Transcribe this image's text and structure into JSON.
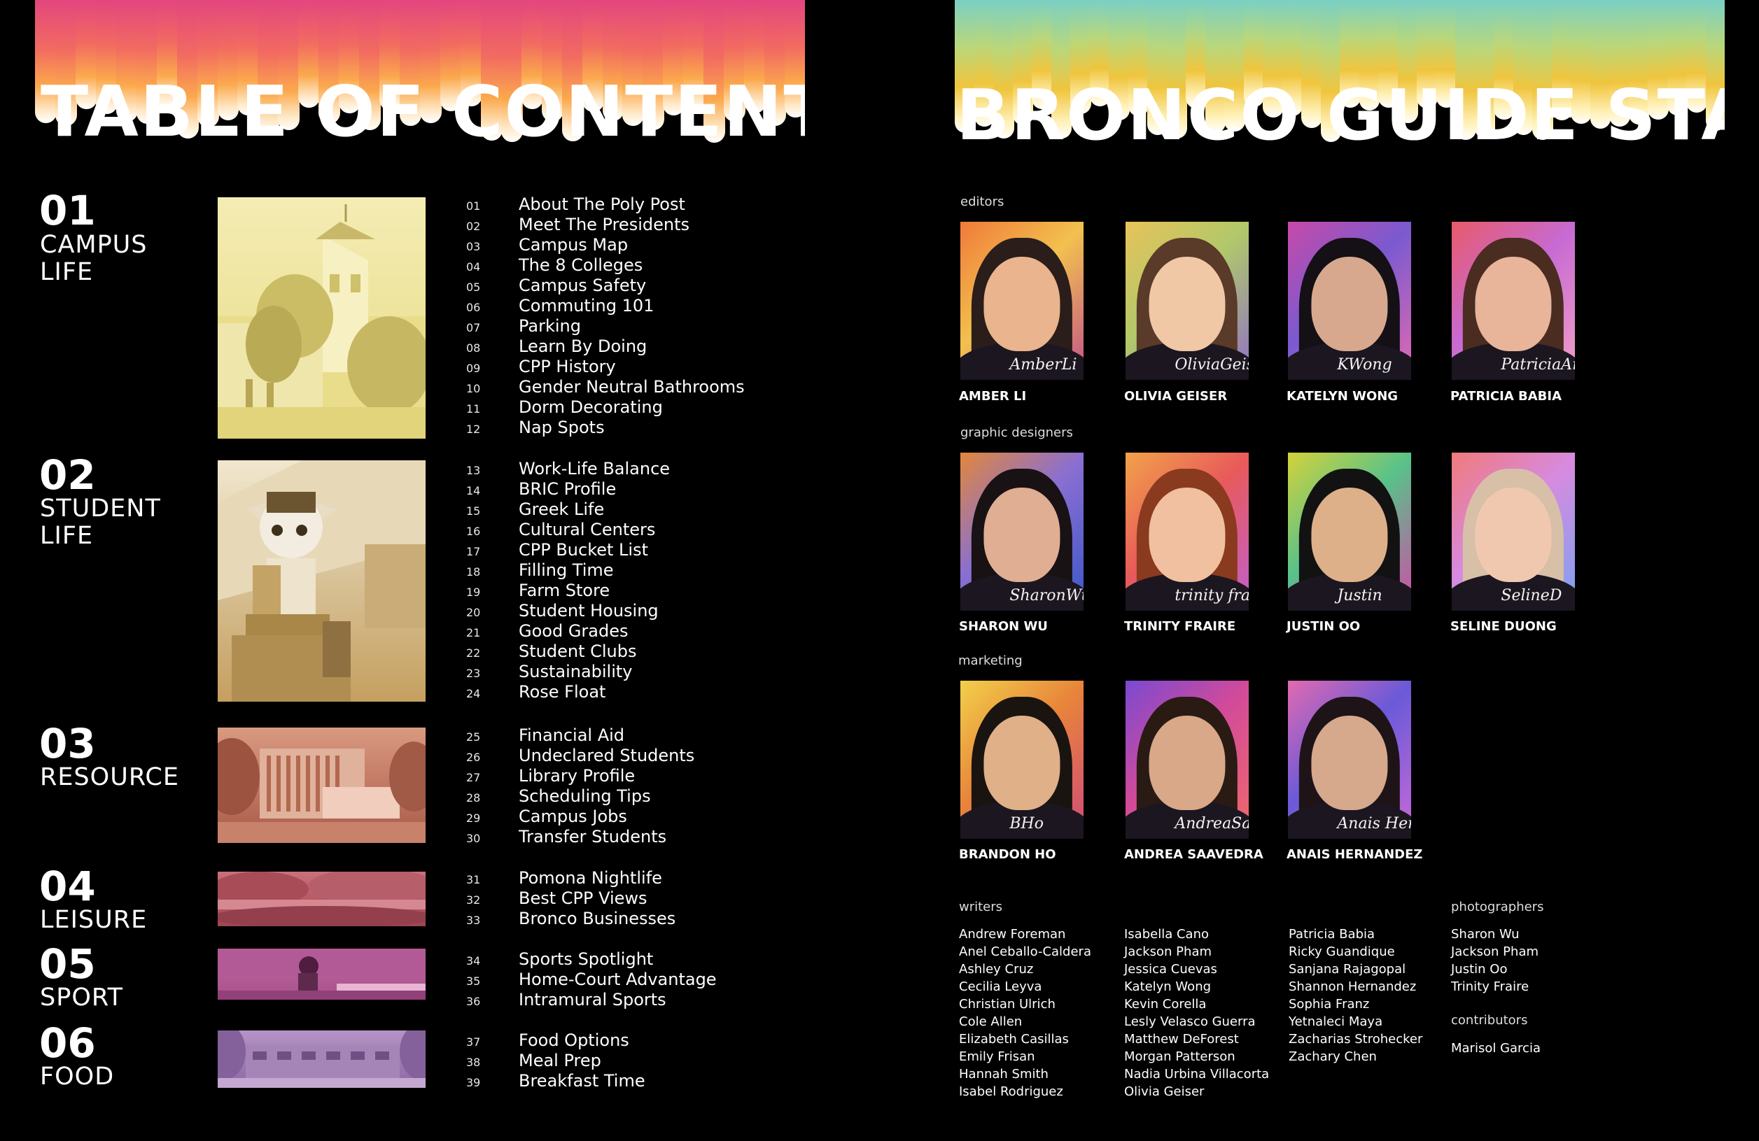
{
  "toc": {
    "title": "TABLE OF CONTENTS",
    "sections": [
      {
        "num": "01",
        "name": "CAMPUS\nLIFE"
      },
      {
        "num": "02",
        "name": "STUDENT\nLIFE"
      },
      {
        "num": "03",
        "name": "RESOURCE"
      },
      {
        "num": "04",
        "name": "LEISURE"
      },
      {
        "num": "05",
        "name": "SPORT"
      },
      {
        "num": "06",
        "name": "FOOD"
      }
    ],
    "groups": [
      [
        {
          "n": "01",
          "label": "About The Poly Post"
        },
        {
          "n": "02",
          "label": "Meet The Presidents"
        },
        {
          "n": "03",
          "label": "Campus Map"
        },
        {
          "n": "04",
          "label": "The 8 Colleges"
        },
        {
          "n": "05",
          "label": "Campus Safety"
        },
        {
          "n": "06",
          "label": "Commuting 101"
        },
        {
          "n": "07",
          "label": "Parking"
        },
        {
          "n": "08",
          "label": "Learn By Doing"
        },
        {
          "n": "09",
          "label": "CPP History"
        },
        {
          "n": "10",
          "label": "Gender Neutral    Bathrooms"
        },
        {
          "n": "11",
          "label": "Dorm Decorating"
        },
        {
          "n": "12",
          "label": "Nap Spots"
        }
      ],
      [
        {
          "n": "13",
          "label": "Work-Life Balance"
        },
        {
          "n": "14",
          "label": "BRIC Profile"
        },
        {
          "n": "15",
          "label": "Greek Life"
        },
        {
          "n": "16",
          "label": "Cultural Centers"
        },
        {
          "n": "17",
          "label": "CPP Bucket List"
        },
        {
          "n": "18",
          "label": "Filling Time"
        },
        {
          "n": "19",
          "label": "Farm Store"
        },
        {
          "n": "20",
          "label": "Student Housing"
        },
        {
          "n": "21",
          "label": "Good Grades"
        },
        {
          "n": "22",
          "label": "Student Clubs"
        },
        {
          "n": "23",
          "label": "Sustainability"
        },
        {
          "n": "24",
          "label": "Rose Float"
        }
      ],
      [
        {
          "n": "25",
          "label": "Financial Aid"
        },
        {
          "n": "26",
          "label": "Undeclared Students"
        },
        {
          "n": "27",
          "label": "Library Profile"
        },
        {
          "n": "28",
          "label": "Scheduling Tips"
        },
        {
          "n": "29",
          "label": "Campus Jobs"
        },
        {
          "n": "30",
          "label": "Transfer Students"
        }
      ],
      [
        {
          "n": "31",
          "label": "Pomona Nightlife"
        },
        {
          "n": "32",
          "label": "Best CPP Views"
        },
        {
          "n": "33",
          "label": "Bronco Businesses"
        }
      ],
      [
        {
          "n": "34",
          "label": "Sports Spotlight"
        },
        {
          "n": "35",
          "label": "Home-Court Advantage"
        },
        {
          "n": "36",
          "label": "Intramural Sports"
        }
      ],
      [
        {
          "n": "37",
          "label": "Food Options"
        },
        {
          "n": "38",
          "label": "Meal Prep"
        },
        {
          "n": "39",
          "label": "Breakfast Time"
        }
      ]
    ]
  },
  "staff": {
    "title": "BRONCO GUIDE STAFF",
    "roles": {
      "editors": "editors",
      "designers": "graphic designers",
      "marketing": "marketing"
    },
    "editors": [
      {
        "name": "AMBER LI",
        "sig": "AmberLi"
      },
      {
        "name": "OLIVIA GEISER",
        "sig": "OliviaGeiser"
      },
      {
        "name": "KATELYN WONG",
        "sig": "KWong"
      },
      {
        "name": "PATRICIA BABIA",
        "sig": "PatriciaAnneBabia"
      }
    ],
    "designers": [
      {
        "name": "SHARON WU",
        "sig": "SharonWu"
      },
      {
        "name": "TRINITY FRAIRE",
        "sig": "trinity fraire"
      },
      {
        "name": "JUSTIN OO",
        "sig": "Justin"
      },
      {
        "name": "SELINE DUONG",
        "sig": "SelineD"
      }
    ],
    "marketing": [
      {
        "name": "BRANDON HO",
        "sig": "BHo"
      },
      {
        "name": "ANDREA SAAVEDRA",
        "sig": "AndreaSaavedra"
      },
      {
        "name": "ANAIS HERNANDEZ",
        "sig": "Anais Hernandez"
      }
    ],
    "credits": {
      "writers_label": "writers",
      "writers_col1": [
        "Andrew Foreman",
        "Anel Ceballo-Caldera",
        "Ashley Cruz",
        "Cecilia Leyva",
        "Christian Ulrich",
        "Cole Allen",
        "Elizabeth Casillas",
        "Emily Frisan",
        "Hannah Smith",
        "Isabel Rodriguez"
      ],
      "writers_col2": [
        "Isabella Cano",
        "Jackson Pham",
        "Jessica Cuevas",
        "Katelyn Wong",
        "Kevin Corella",
        "Lesly Velasco Guerra",
        "Matthew DeForest",
        "Morgan Patterson",
        "Nadia Urbina Villacorta",
        "Olivia Geiser"
      ],
      "writers_col3": [
        "Patricia Babia",
        "Ricky Guandique",
        "Sanjana Rajagopal",
        "Shannon Hernandez",
        "Sophia Franz",
        "Yetnaleci Maya",
        "Zacharias Strohecker",
        "Zachary Chen"
      ],
      "photographers_label": "photographers",
      "photographers": [
        "Sharon Wu",
        "Jackson Pham",
        "Justin Oo",
        "Trinity Fraire"
      ],
      "contributors_label": "contributors",
      "contributors": [
        "Marisol Garcia"
      ]
    }
  }
}
